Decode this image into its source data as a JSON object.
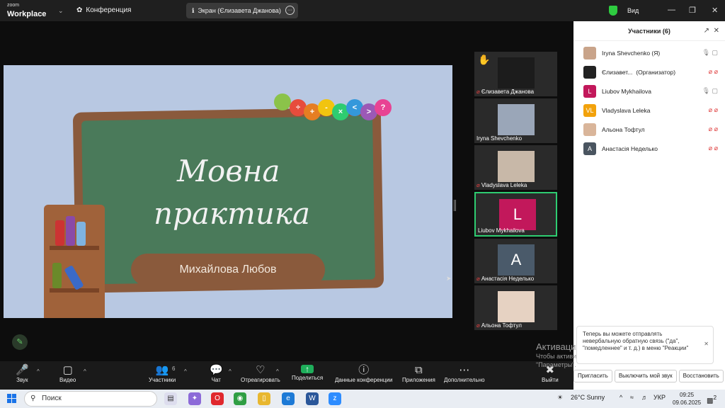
{
  "topbar": {
    "logo_top": "zoom",
    "logo_bottom": "Workplace",
    "meeting_label": "Конференция",
    "share_label": "Экран (Єлизавета Джанова)",
    "view_label": "Вид"
  },
  "slide": {
    "title_line1": "Мовна",
    "title_line2": "практика",
    "author": "Михайлова Любов",
    "caterpillar_symbols": [
      "÷",
      "+",
      "-",
      "×",
      "<",
      ">",
      "?"
    ]
  },
  "tiles": [
    {
      "name": "Єлизавета Джанова",
      "muted": true,
      "initial": "",
      "color": "#1c1c1c",
      "hand": "✋"
    },
    {
      "name": "Iryna Shevchenko",
      "muted": false,
      "initial": "",
      "color": "#9aa6b8",
      "hand": ""
    },
    {
      "name": "Vladyslava Leleka",
      "muted": true,
      "initial": "",
      "color": "#c8b8a8",
      "hand": ""
    },
    {
      "name": "Liubov Mykhailova",
      "muted": false,
      "initial": "L",
      "color": "#c2185b",
      "hand": ""
    },
    {
      "name": "Анастасія Неделько",
      "muted": true,
      "initial": "A",
      "color": "#4a5a6a",
      "hand": ""
    },
    {
      "name": "Альона Тофтул",
      "muted": true,
      "initial": "",
      "color": "#e6d2c2",
      "hand": ""
    }
  ],
  "toolbar": {
    "audio": "Звук",
    "video": "Видео",
    "participants": "Участники",
    "participants_count": "6",
    "chat": "Чат",
    "react": "Отреагировать",
    "share": "Поделиться",
    "info": "Данные конференции",
    "apps": "Приложения",
    "more": "Дополнительно",
    "leave": "Выйти"
  },
  "panel": {
    "title": "Участники (6)",
    "participants": [
      {
        "name": "Iryna Shevchenko (Я)",
        "initial": "",
        "color": "#c9a48a"
      },
      {
        "name": "Єлизавет...",
        "role": "(Организатор)",
        "initial": "",
        "color": "#222222"
      },
      {
        "name": "Liubov Mykhailova",
        "initial": "L",
        "color": "#c2185b"
      },
      {
        "name": "Vladyslava Leleka",
        "initial": "VL",
        "color": "#f2a20c"
      },
      {
        "name": "Альона Тофтул",
        "initial": "",
        "color": "#d9b59a"
      },
      {
        "name": "Анастасія Неделько",
        "initial": "A",
        "color": "#4a5560"
      }
    ],
    "toast_line1": "Теперь вы можете отправлять",
    "toast_line2": "невербальную обратную связь (\"да\",",
    "toast_line3": "\"помедленнее\" и т. д.) в меню \"Реакции\"",
    "btn_invite": "Пригласить",
    "btn_mute_me": "Выключить мой звук",
    "btn_restore": "Восстановить"
  },
  "watermark": {
    "line1": "Активация Windows",
    "line2": "Чтобы активировать Windows, перейдите в раздел",
    "line3": "\"Параметры\"."
  },
  "taskbar": {
    "search": "Поиск",
    "weather": "26°C  Sunny",
    "lang": "УКР",
    "time": "09:25",
    "date": "09.06.2025",
    "notif_count": "2"
  }
}
